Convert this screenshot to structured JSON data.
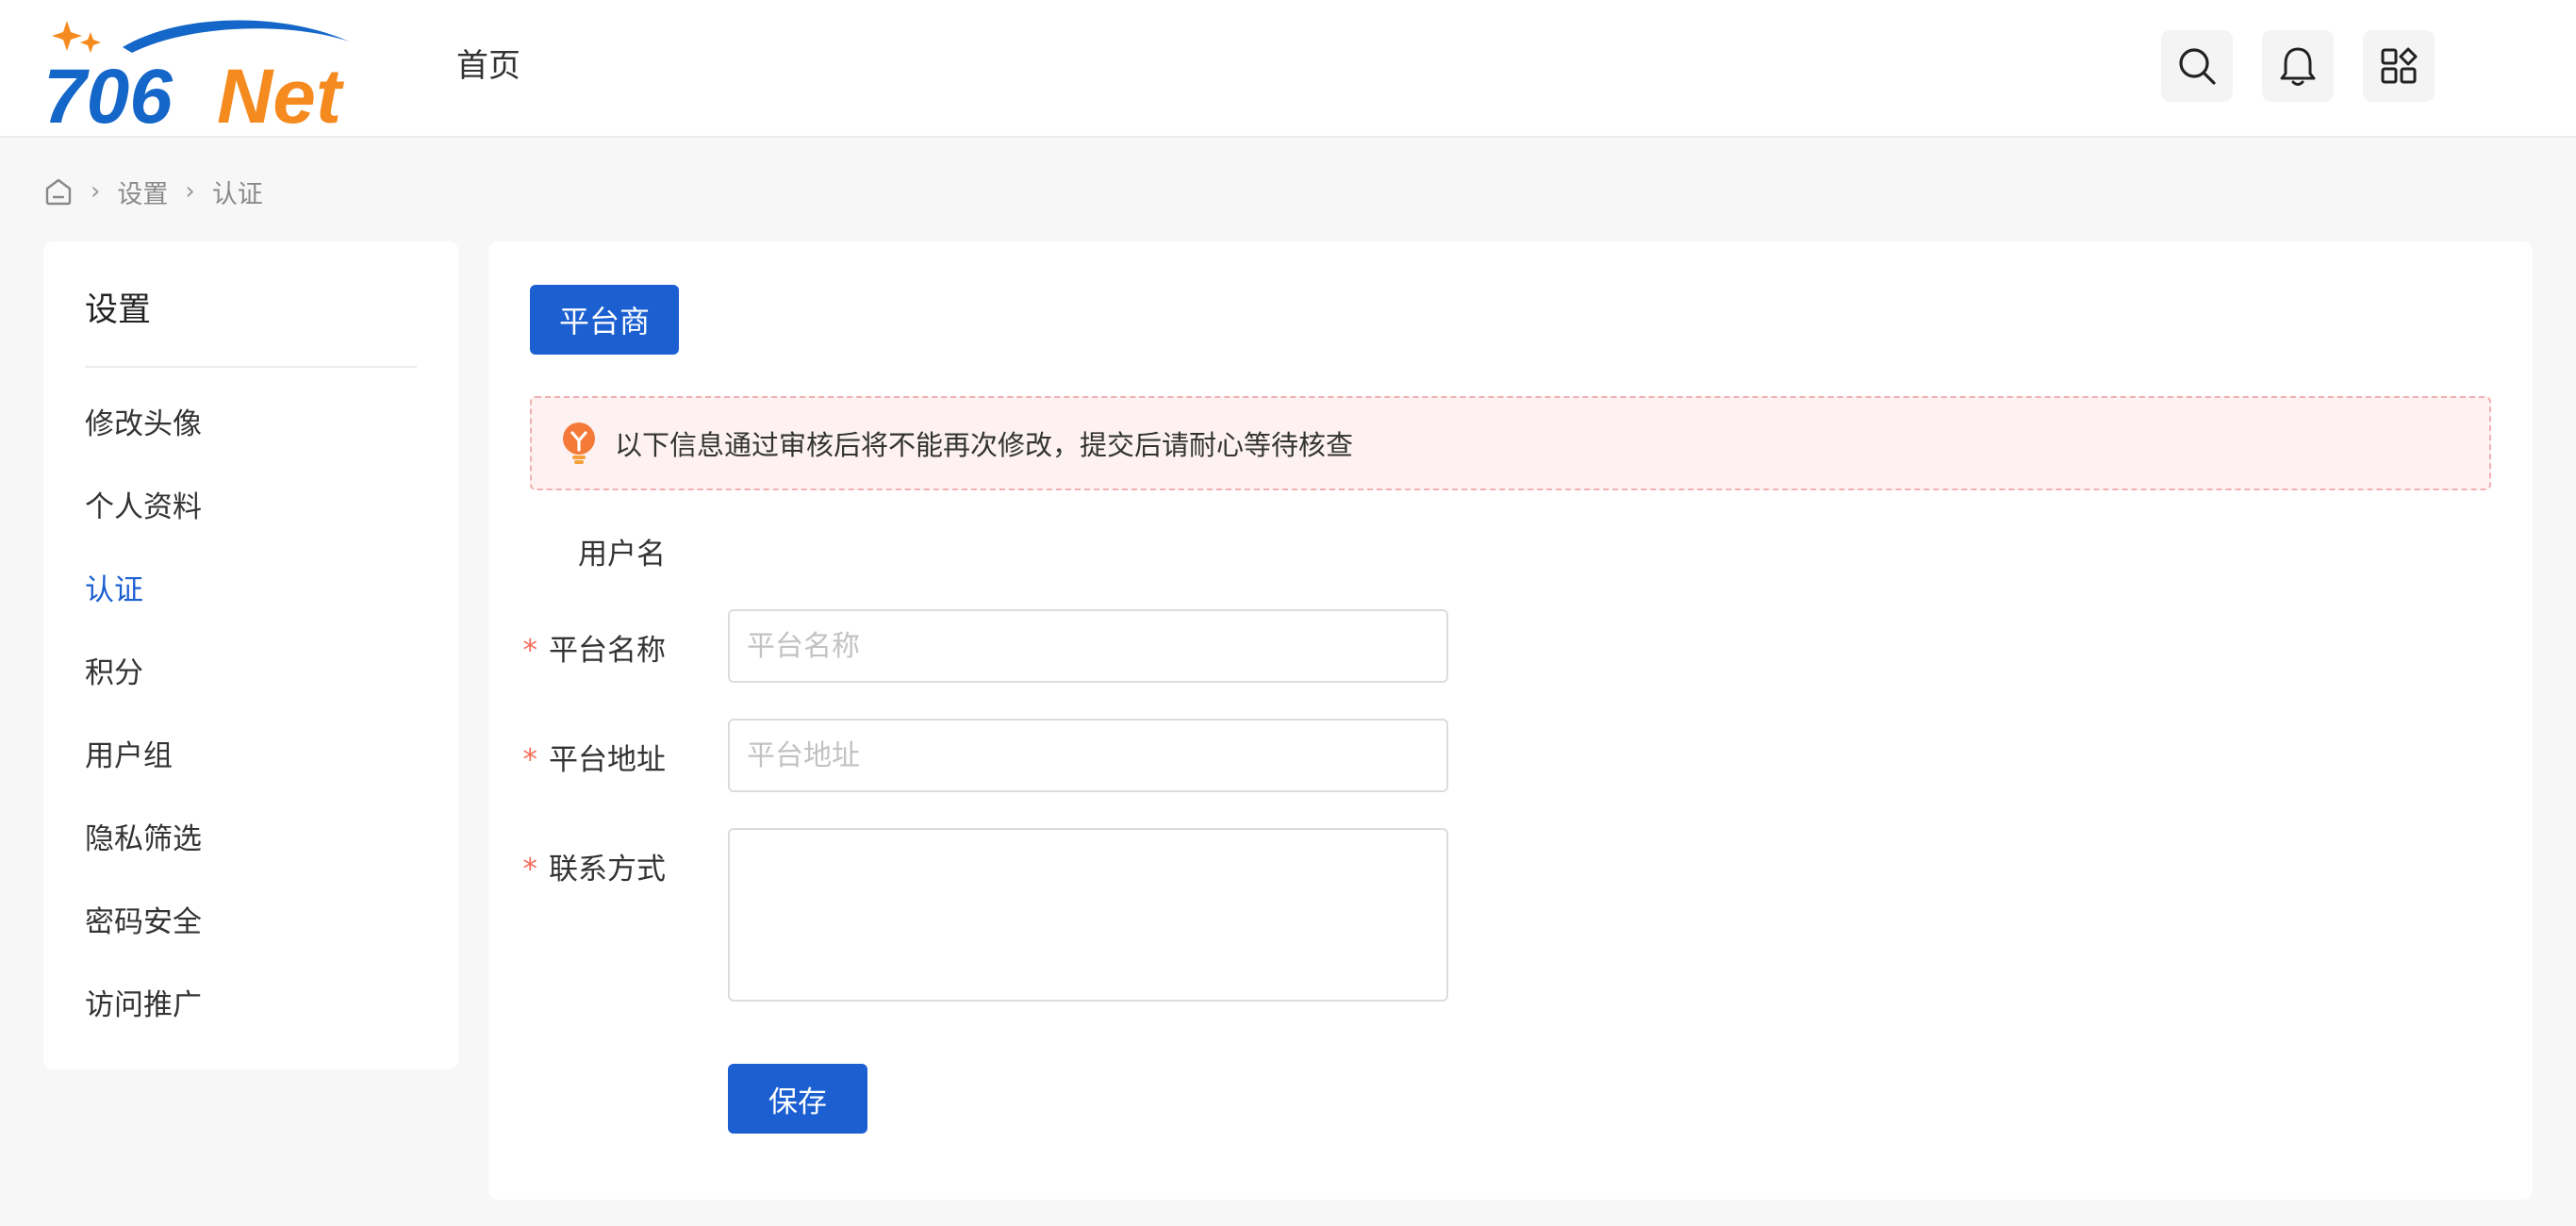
{
  "header": {
    "logo_text_blue": "706",
    "logo_text_orange": "Net",
    "nav_home": "首页",
    "icons": [
      "search-icon",
      "bell-icon",
      "apps-icon"
    ]
  },
  "breadcrumb": {
    "home_icon": "home-icon",
    "items": [
      "设置",
      "认证"
    ]
  },
  "sidebar": {
    "title": "设置",
    "items": [
      {
        "label": "修改头像",
        "active": false
      },
      {
        "label": "个人资料",
        "active": false
      },
      {
        "label": "认证",
        "active": true
      },
      {
        "label": "积分",
        "active": false
      },
      {
        "label": "用户组",
        "active": false
      },
      {
        "label": "隐私筛选",
        "active": false
      },
      {
        "label": "密码安全",
        "active": false
      },
      {
        "label": "访问推广",
        "active": false
      }
    ]
  },
  "main": {
    "tab_label": "平台商",
    "notice": "以下信息通过审核后将不能再次修改，提交后请耐心等待核查",
    "form": {
      "username_label": "用户名",
      "required_mark": "*",
      "platform_name_label": "平台名称",
      "platform_name_placeholder": "平台名称",
      "platform_name_value": "",
      "platform_url_label": "平台地址",
      "platform_url_placeholder": "平台地址",
      "platform_url_value": "",
      "contact_label": "联系方式",
      "contact_value": ""
    },
    "save_label": "保存"
  },
  "colors": {
    "primary": "#1b5fd1",
    "logo_blue": "#1466c8",
    "logo_orange": "#f58a1f",
    "required": "#f56c5a",
    "notice_bg": "#fdf2f1",
    "notice_border": "#f2b0b0"
  }
}
